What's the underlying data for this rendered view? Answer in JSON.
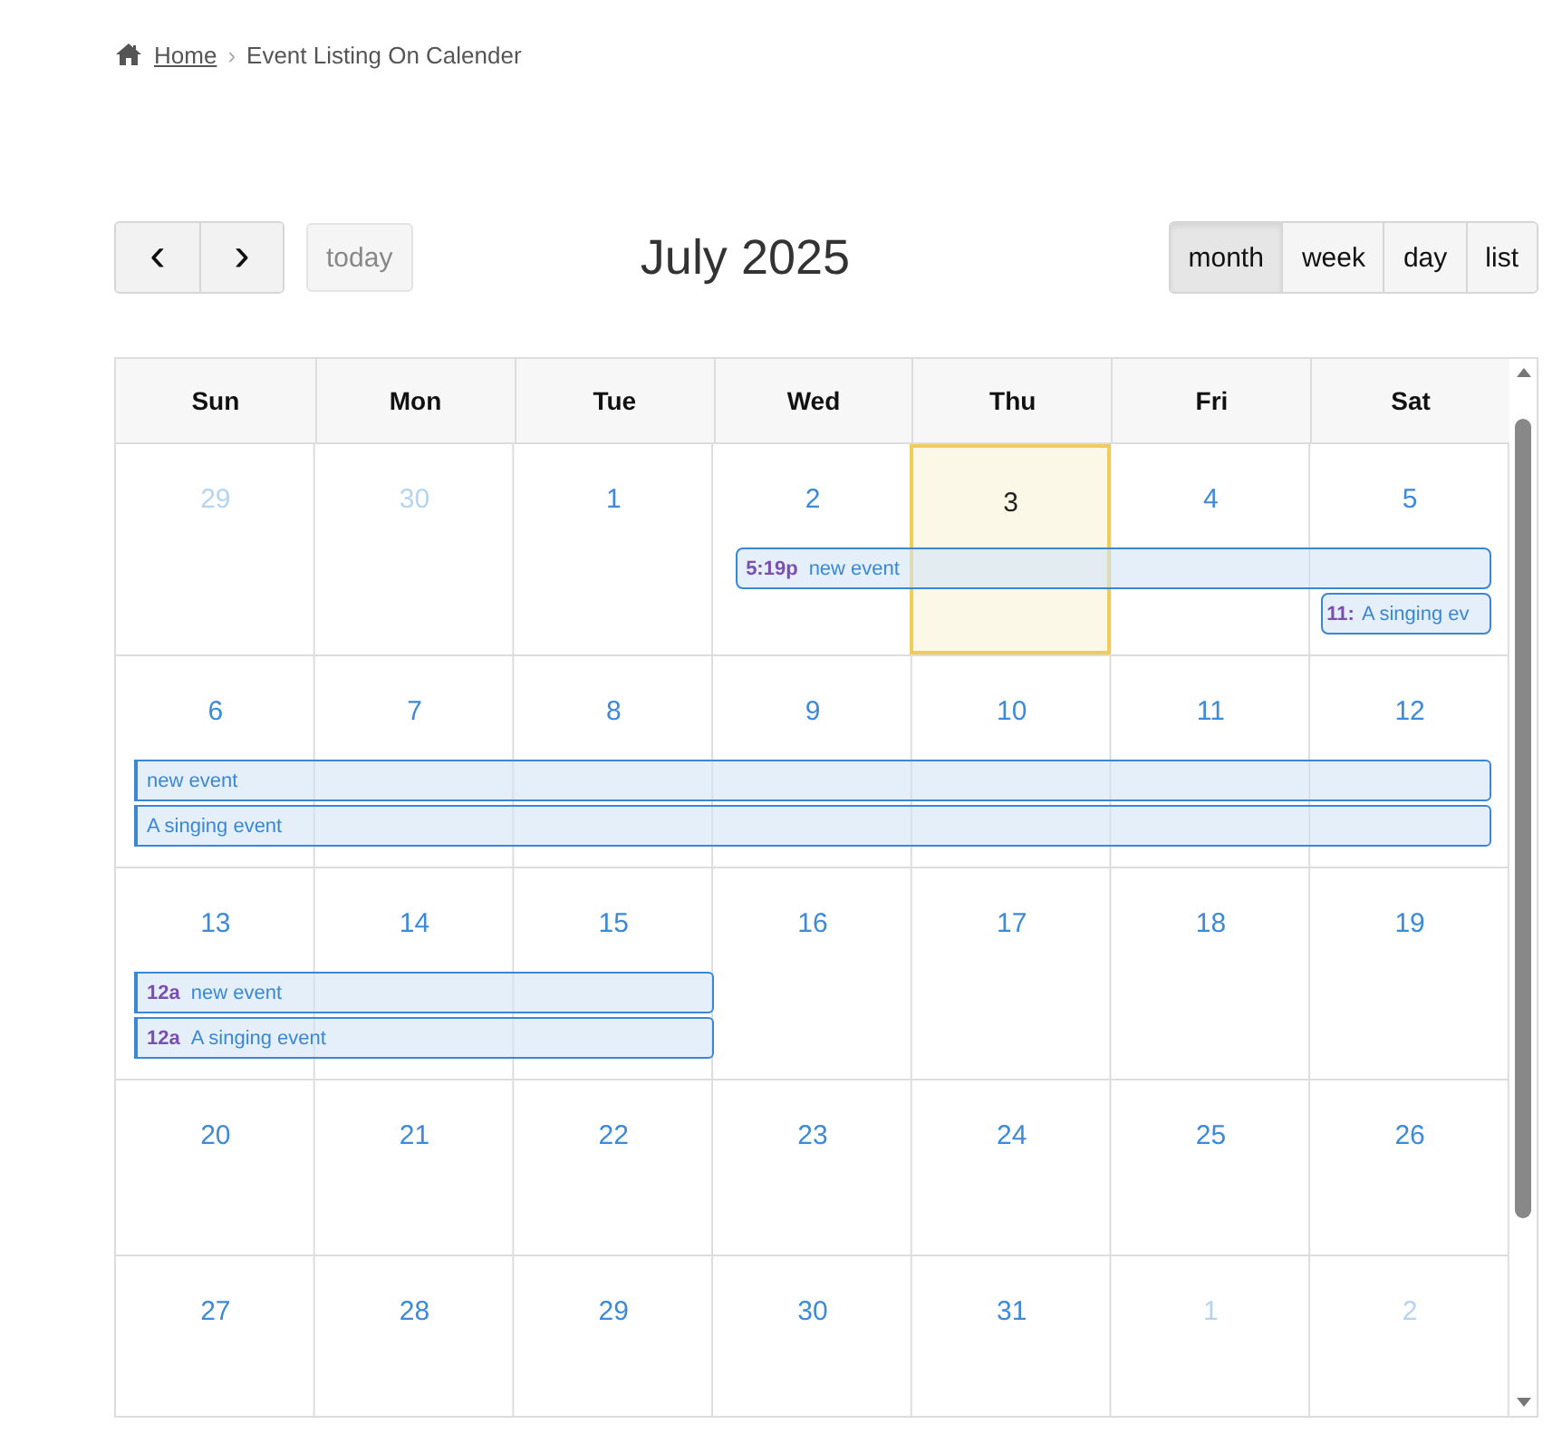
{
  "breadcrumb": {
    "home": "Home",
    "separator": "›",
    "current": "Event Listing On Calender"
  },
  "toolbar": {
    "prev": "‹",
    "next": "›",
    "today": {
      "label": "today",
      "disabled": true
    },
    "title": "July 2025",
    "views": [
      {
        "label": "month",
        "selected": true
      },
      {
        "label": "week",
        "selected": false
      },
      {
        "label": "day",
        "selected": false
      },
      {
        "label": "list",
        "selected": false
      }
    ]
  },
  "weekdays": [
    "Sun",
    "Mon",
    "Tue",
    "Wed",
    "Thu",
    "Fri",
    "Sat"
  ],
  "weeks": [
    {
      "days": [
        {
          "label": "29",
          "other_month": true,
          "today": false
        },
        {
          "label": "30",
          "other_month": true,
          "today": false
        },
        {
          "label": "1",
          "other_month": false,
          "today": false
        },
        {
          "label": "2",
          "other_month": false,
          "today": false
        },
        {
          "label": "3",
          "other_month": false,
          "today": true
        },
        {
          "label": "4",
          "other_month": false,
          "today": false
        },
        {
          "label": "5",
          "other_month": false,
          "today": false
        }
      ],
      "events": [
        {
          "time": "5:19p",
          "title": "new event",
          "continues_before": false
        },
        {
          "time": "11:",
          "title": "A singing ev",
          "continues_before": false
        }
      ]
    },
    {
      "days": [
        {
          "label": "6",
          "other_month": false,
          "today": false
        },
        {
          "label": "7",
          "other_month": false,
          "today": false
        },
        {
          "label": "8",
          "other_month": false,
          "today": false
        },
        {
          "label": "9",
          "other_month": false,
          "today": false
        },
        {
          "label": "10",
          "other_month": false,
          "today": false
        },
        {
          "label": "11",
          "other_month": false,
          "today": false
        },
        {
          "label": "12",
          "other_month": false,
          "today": false
        }
      ],
      "events": [
        {
          "title": "new event",
          "continues_before": true
        },
        {
          "title": "A singing event",
          "continues_before": true
        }
      ]
    },
    {
      "days": [
        {
          "label": "13",
          "other_month": false,
          "today": false
        },
        {
          "label": "14",
          "other_month": false,
          "today": false
        },
        {
          "label": "15",
          "other_month": false,
          "today": false
        },
        {
          "label": "16",
          "other_month": false,
          "today": false
        },
        {
          "label": "17",
          "other_month": false,
          "today": false
        },
        {
          "label": "18",
          "other_month": false,
          "today": false
        },
        {
          "label": "19",
          "other_month": false,
          "today": false
        }
      ],
      "events": [
        {
          "time": "12a",
          "title": "new event",
          "continues_before": true
        },
        {
          "time": "12a",
          "title": "A singing event",
          "continues_before": true
        }
      ]
    },
    {
      "days": [
        {
          "label": "20",
          "other_month": false,
          "today": false
        },
        {
          "label": "21",
          "other_month": false,
          "today": false
        },
        {
          "label": "22",
          "other_month": false,
          "today": false
        },
        {
          "label": "23",
          "other_month": false,
          "today": false
        },
        {
          "label": "24",
          "other_month": false,
          "today": false
        },
        {
          "label": "25",
          "other_month": false,
          "today": false
        },
        {
          "label": "26",
          "other_month": false,
          "today": false
        }
      ]
    },
    {
      "days": [
        {
          "label": "27",
          "other_month": false,
          "today": false
        },
        {
          "label": "28",
          "other_month": false,
          "today": false
        },
        {
          "label": "29",
          "other_month": false,
          "today": false
        },
        {
          "label": "30",
          "other_month": false,
          "today": false
        },
        {
          "label": "31",
          "other_month": false,
          "today": false
        },
        {
          "label": "1",
          "other_month": true,
          "today": false
        },
        {
          "label": "2",
          "other_month": true,
          "today": false
        }
      ]
    }
  ]
}
